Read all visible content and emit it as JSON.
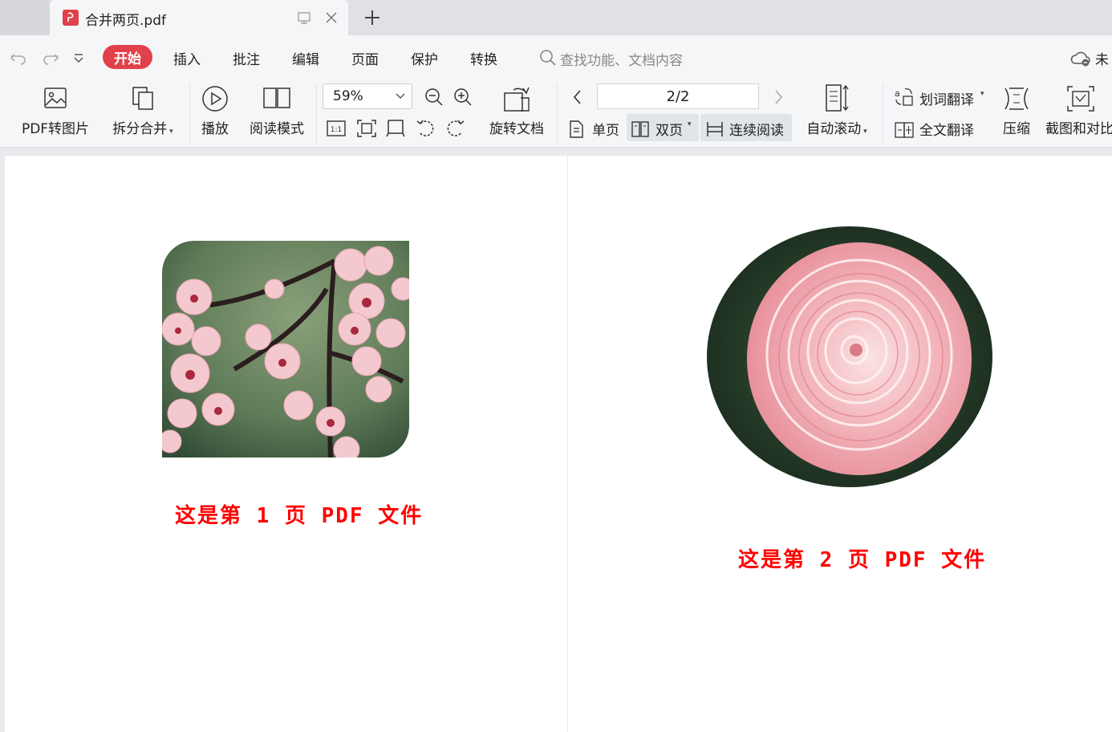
{
  "tabs": {
    "active_title": "合并两页.pdf",
    "new_tab_icon": "plus-icon"
  },
  "menu": {
    "items": [
      "开始",
      "插入",
      "批注",
      "编辑",
      "页面",
      "保护",
      "转换"
    ],
    "active": "开始",
    "search_placeholder": "查找功能、文档内容",
    "account_text": "未"
  },
  "ribbon": {
    "pdf_to_image": "PDF转图片",
    "split_merge": "拆分合并",
    "play": "播放",
    "read_mode": "阅读模式",
    "zoom": "59%",
    "rotate_doc": "旋转文档",
    "page_indicator": "2/2",
    "single_page": "单页",
    "double_page": "双页",
    "continuous_read": "连续阅读",
    "auto_scroll": "自动滚动",
    "word_translate": "划词翻译",
    "full_translate": "全文翻译",
    "compress": "压缩",
    "screenshot_compare": "截图和对比"
  },
  "pages": {
    "page1_caption": "这是第 1 页 PDF 文件",
    "page2_caption": "这是第 2 页 PDF 文件"
  },
  "colors": {
    "accent": "#e2404a",
    "caption": "#ff0000"
  }
}
